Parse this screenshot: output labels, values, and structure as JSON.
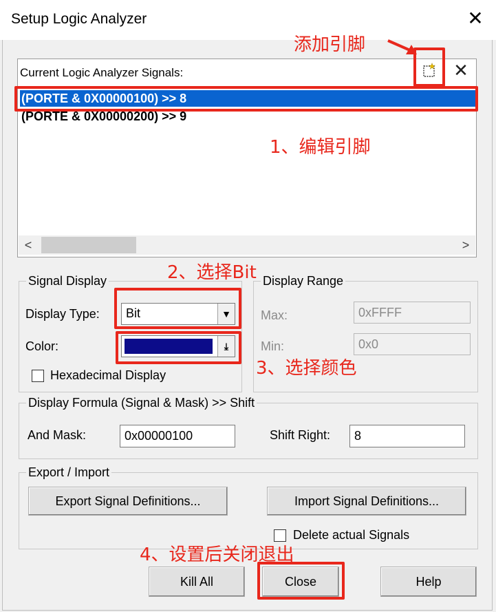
{
  "window": {
    "title": "Setup Logic Analyzer",
    "close_glyph": "✕"
  },
  "signals": {
    "label": "Current Logic Analyzer Signals:",
    "items": [
      {
        "text": "(PORTE & 0X00000100) >> 8",
        "selected": true
      },
      {
        "text": "(PORTE & 0X00000200) >> 9",
        "selected": false
      }
    ],
    "new_icon": "new-signal-icon",
    "delete_icon": "delete-signal-icon",
    "scroll_left": "<",
    "scroll_right": ">"
  },
  "signal_display": {
    "legend": "Signal Display",
    "display_type_label": "Display Type:",
    "display_type_value": "Bit",
    "color_label": "Color:",
    "color_value": "#0c0c8a",
    "hex_label": "Hexadecimal Display",
    "hex_checked": false
  },
  "display_range": {
    "legend": "Display Range",
    "max_label": "Max:",
    "max_value": "0xFFFF",
    "min_label": "Min:",
    "min_value": "0x0"
  },
  "formula": {
    "legend": "Display Formula (Signal & Mask) >> Shift",
    "mask_label": "And Mask:",
    "mask_value": "0x00000100",
    "shift_label": "Shift Right:",
    "shift_value": "8"
  },
  "export_import": {
    "legend": "Export / Import",
    "export_label": "Export Signal Definitions...",
    "import_label": "Import Signal Definitions...",
    "delete_label": "Delete actual Signals",
    "delete_checked": false
  },
  "buttons": {
    "kill_all": "Kill All",
    "close": "Close",
    "help": "Help"
  },
  "annotations": {
    "add_pin": "添加引脚",
    "edit_pin": "1、编辑引脚",
    "select_bit": "2、选择Bit",
    "select_color": "3、选择颜色",
    "close_exit": "4、设置后关闭退出"
  },
  "colors": {
    "annotation": "#e8271c",
    "selection": "#0a64d0"
  }
}
